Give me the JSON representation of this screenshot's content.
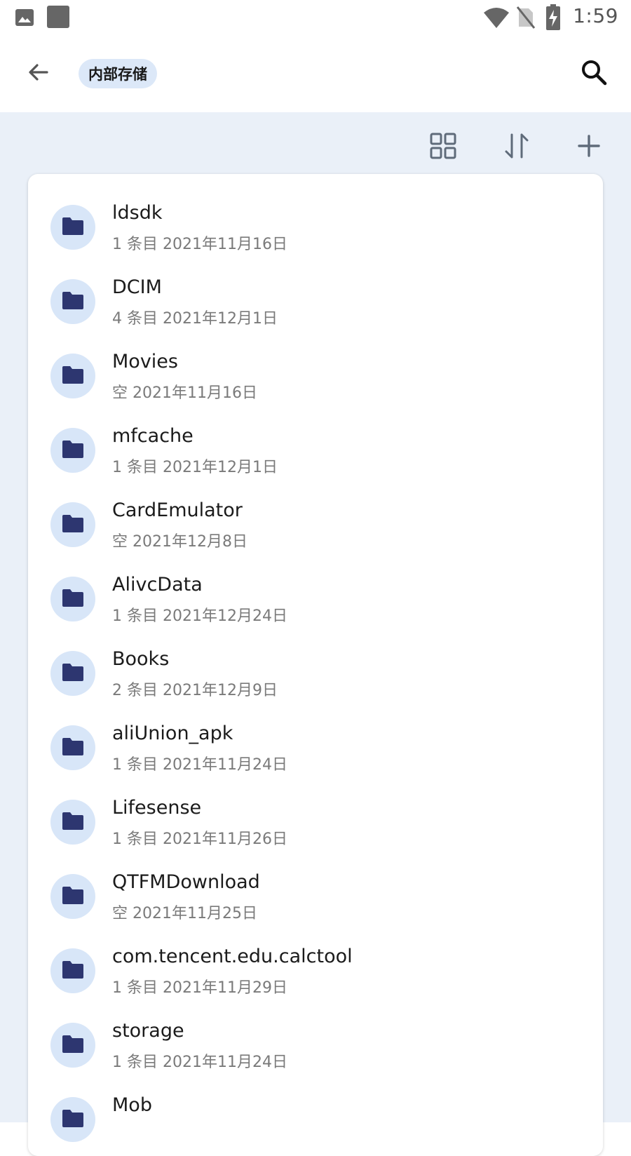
{
  "status_bar": {
    "time": "1:59",
    "left_icons": [
      "image-icon",
      "square-icon"
    ],
    "right_icons": [
      "wifi-icon",
      "no-sim-icon",
      "battery-charging-icon"
    ]
  },
  "app_bar": {
    "breadcrumb": "内部存储",
    "back_icon": "arrow-back-icon",
    "search_icon": "search-icon"
  },
  "toolbar": {
    "icons": [
      "grid-view-icon",
      "sort-icon",
      "add-icon"
    ]
  },
  "files": [
    {
      "name": "ldsdk",
      "meta": "1 条目  2021年11月16日"
    },
    {
      "name": "DCIM",
      "meta": "4 条目  2021年12月1日"
    },
    {
      "name": "Movies",
      "meta": "空  2021年11月16日"
    },
    {
      "name": "mfcache",
      "meta": "1 条目  2021年12月1日"
    },
    {
      "name": "CardEmulator",
      "meta": "空  2021年12月8日"
    },
    {
      "name": "AlivcData",
      "meta": "1 条目  2021年12月24日"
    },
    {
      "name": "Books",
      "meta": "2 条目  2021年12月9日"
    },
    {
      "name": "aliUnion_apk",
      "meta": "1 条目  2021年11月24日"
    },
    {
      "name": "Lifesense",
      "meta": "1 条目  2021年11月26日"
    },
    {
      "name": "QTFMDownload",
      "meta": "空  2021年11月25日"
    },
    {
      "name": "com.tencent.edu.calctool",
      "meta": "1 条目  2021年11月29日"
    },
    {
      "name": "storage",
      "meta": "1 条目  2021年11月24日"
    },
    {
      "name": "Mob",
      "meta": ""
    }
  ],
  "colors": {
    "accent_bg": "#eaf0f8",
    "chip_bg": "#dce8f8",
    "folder_icon": "#2d3670",
    "icon_gray": "#5f6b7a"
  }
}
